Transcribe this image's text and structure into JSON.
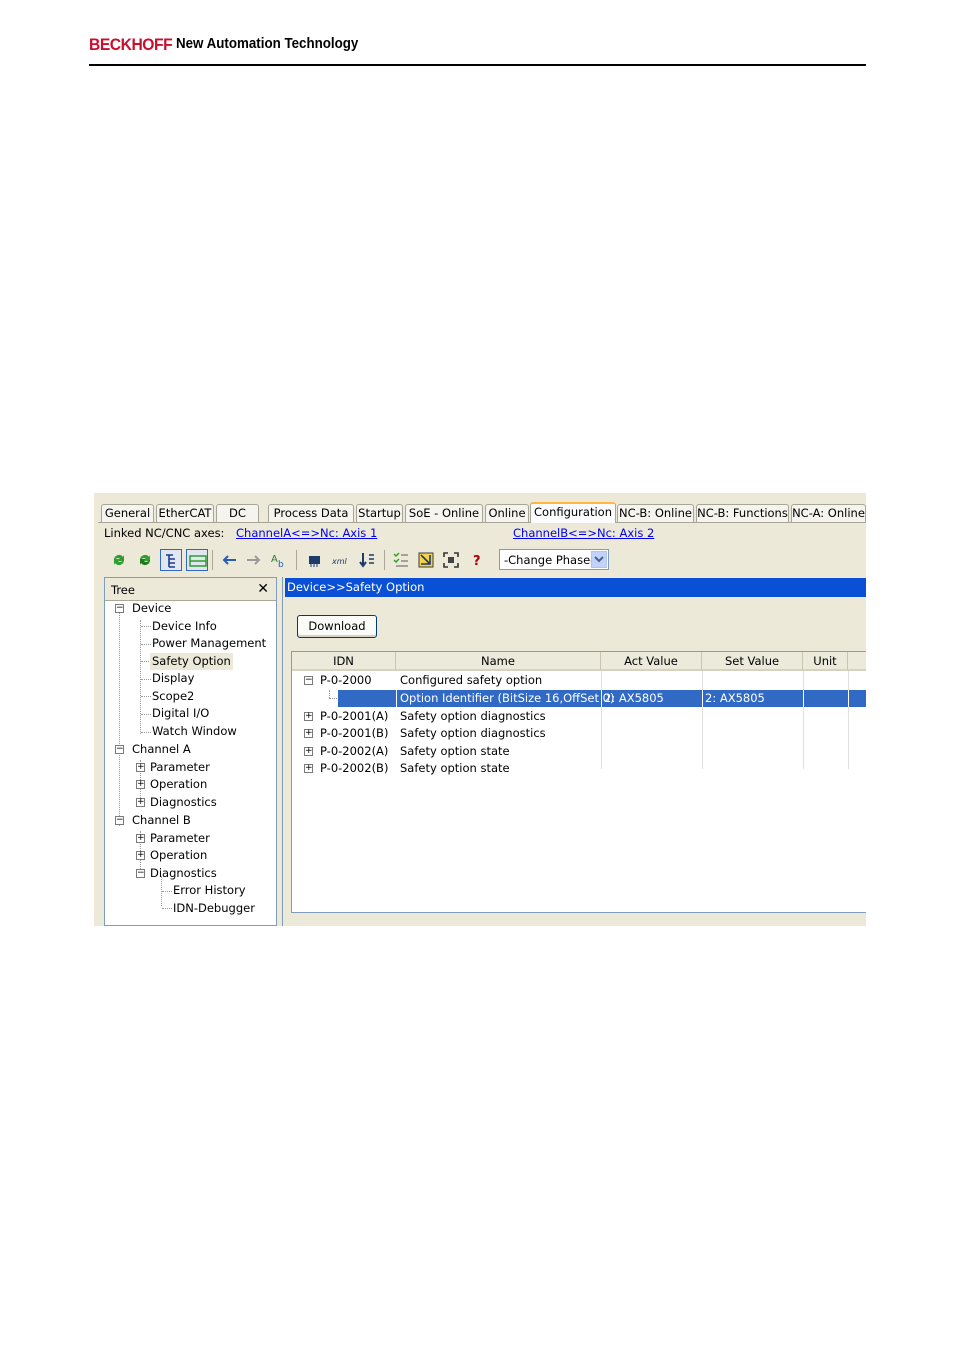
{
  "header": {
    "brand": "BECKHOFF",
    "tagline": "New Automation Technology",
    "brand_color": "#c8102e"
  },
  "tabs": [
    {
      "label": "General",
      "active": false
    },
    {
      "label": "EtherCAT",
      "active": false
    },
    {
      "label": "DC",
      "active": false
    },
    {
      "label": "Process Data",
      "active": false
    },
    {
      "label": "Startup",
      "active": false
    },
    {
      "label": "SoE - Online",
      "active": false
    },
    {
      "label": "Online",
      "active": false
    },
    {
      "label": "Configuration",
      "active": true
    },
    {
      "label": "NC-B: Online",
      "active": false
    },
    {
      "label": "NC-B: Functions",
      "active": false
    },
    {
      "label": "NC-A: Online",
      "active": false
    }
  ],
  "linked": {
    "label": "Linked NC/CNC axes:",
    "channel_a": "ChannelA<=>Nc: Axis 1",
    "channel_b": "ChannelB<=>Nc: Axis 2"
  },
  "toolbar": {
    "icons": [
      "refresh-green-icon",
      "refresh-single-icon",
      "tree-view-icon",
      "list-view-icon",
      "arrow-left-icon",
      "arrow-right-icon",
      "text-edit-icon",
      "chip-icon",
      "xml-icon",
      "import-icon",
      "checklist-icon",
      "select-icon",
      "grid-select-icon",
      "help-icon"
    ],
    "phase_select": "-Change Phase-"
  },
  "tree": {
    "title": "Tree",
    "close": "✕",
    "items": [
      {
        "label": "Device",
        "level": 0,
        "expander": "−"
      },
      {
        "label": "Device Info",
        "level": 1,
        "expander": ""
      },
      {
        "label": "Power Management",
        "level": 1,
        "expander": ""
      },
      {
        "label": "Safety Option",
        "level": 1,
        "expander": "",
        "selected": true
      },
      {
        "label": "Display",
        "level": 1,
        "expander": ""
      },
      {
        "label": "Scope2",
        "level": 1,
        "expander": ""
      },
      {
        "label": "Digital I/O",
        "level": 1,
        "expander": ""
      },
      {
        "label": "Watch Window",
        "level": 1,
        "expander": ""
      },
      {
        "label": "Channel A",
        "level": 0,
        "expander": "−"
      },
      {
        "label": "Parameter",
        "level": 1,
        "expander": "+"
      },
      {
        "label": "Operation",
        "level": 1,
        "expander": "+"
      },
      {
        "label": "Diagnostics",
        "level": 1,
        "expander": "+"
      },
      {
        "label": "Channel B",
        "level": 0,
        "expander": "−"
      },
      {
        "label": "Parameter",
        "level": 1,
        "expander": "+"
      },
      {
        "label": "Operation",
        "level": 1,
        "expander": "+"
      },
      {
        "label": "Diagnostics",
        "level": 1,
        "expander": "−"
      },
      {
        "label": "Error History",
        "level": 2,
        "expander": ""
      },
      {
        "label": "IDN-Debugger",
        "level": 2,
        "expander": ""
      }
    ]
  },
  "main": {
    "path": "Device>>Safety Option",
    "download_label": "Download",
    "columns": [
      "IDN",
      "Name",
      "Act Value",
      "Set Value",
      "Unit"
    ],
    "rows": [
      {
        "expander": "−",
        "idn": "P-0-2000",
        "name": "Configured safety option",
        "act": "",
        "set": "",
        "unit": "",
        "child": false,
        "selected": false
      },
      {
        "expander": "",
        "idn": "",
        "name": "Option Identifier (BitSize 16,OffSet 0)",
        "act": "2: AX5805",
        "set": "2: AX5805",
        "unit": "",
        "child": true,
        "selected": true
      },
      {
        "expander": "+",
        "idn": "P-0-2001(A)",
        "name": "Safety option diagnostics",
        "act": "",
        "set": "",
        "unit": "",
        "child": false,
        "selected": false
      },
      {
        "expander": "+",
        "idn": "P-0-2001(B)",
        "name": "Safety option diagnostics",
        "act": "",
        "set": "",
        "unit": "",
        "child": false,
        "selected": false
      },
      {
        "expander": "+",
        "idn": "P-0-2002(A)",
        "name": "Safety option state",
        "act": "",
        "set": "",
        "unit": "",
        "child": false,
        "selected": false
      },
      {
        "expander": "+",
        "idn": "P-0-2002(B)",
        "name": "Safety option state",
        "act": "",
        "set": "",
        "unit": "",
        "child": false,
        "selected": false
      }
    ]
  }
}
